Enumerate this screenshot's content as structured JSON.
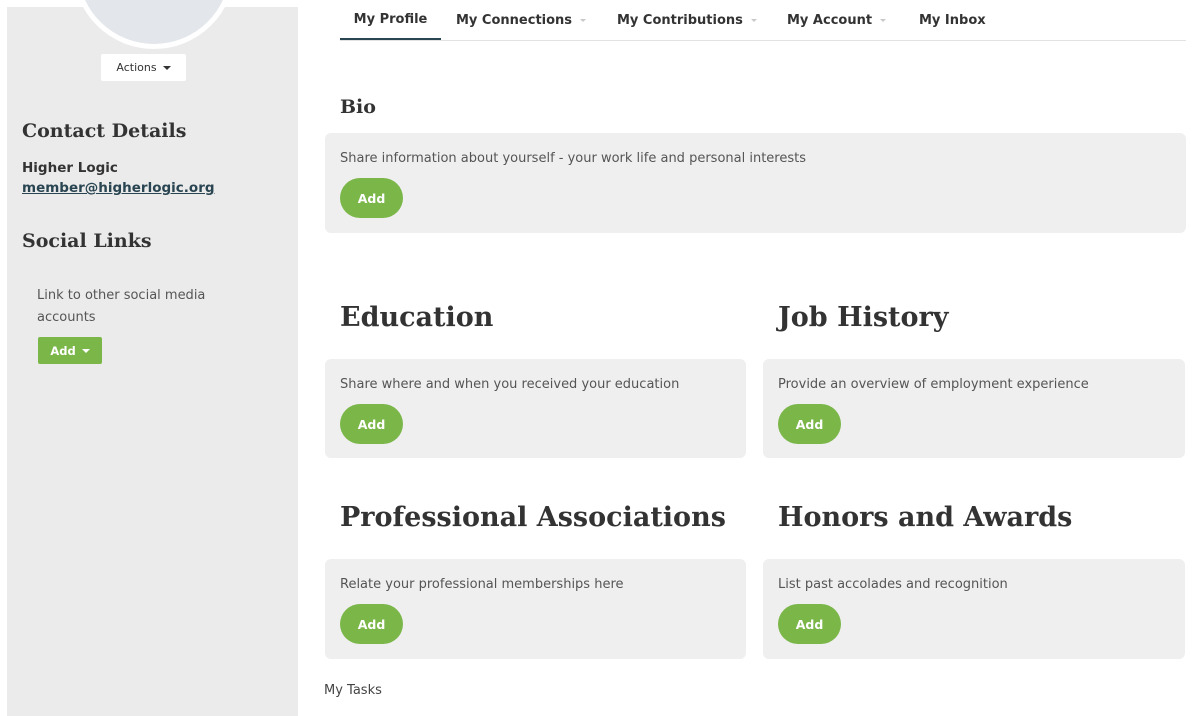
{
  "sidebar": {
    "actions_label": "Actions",
    "contact_heading": "Contact Details",
    "contact_name": "Higher Logic",
    "contact_email": "member@higherlogic.org",
    "social_heading": "Social Links",
    "social_text": "Link to other social media accounts",
    "social_add_label": "Add"
  },
  "tabs": [
    {
      "label": "My Profile",
      "active": true,
      "dropdown": false
    },
    {
      "label": "My Connections",
      "active": false,
      "dropdown": true
    },
    {
      "label": "My Contributions",
      "active": false,
      "dropdown": true
    },
    {
      "label": "My Account",
      "active": false,
      "dropdown": true
    },
    {
      "label": "My Inbox",
      "active": false,
      "dropdown": false
    }
  ],
  "bio": {
    "title": "Bio",
    "text": "Share information about yourself - your work life and personal interests",
    "add_label": "Add"
  },
  "education": {
    "title": "Education",
    "text": "Share where and when you received your education",
    "add_label": "Add"
  },
  "job_history": {
    "title": "Job History",
    "text": "Provide an overview of employment experience",
    "add_label": "Add"
  },
  "professional_associations": {
    "title": "Professional Associations",
    "text": "Relate your professional memberships here",
    "add_label": "Add"
  },
  "honors_awards": {
    "title": "Honors and Awards",
    "text": "List past accolades and recognition",
    "add_label": "Add"
  },
  "my_tasks": "My Tasks",
  "colors": {
    "accent_green": "#7ab648",
    "sidebar_bg": "#ebebeb",
    "card_bg": "#efefef",
    "link_color": "#2a4552"
  }
}
